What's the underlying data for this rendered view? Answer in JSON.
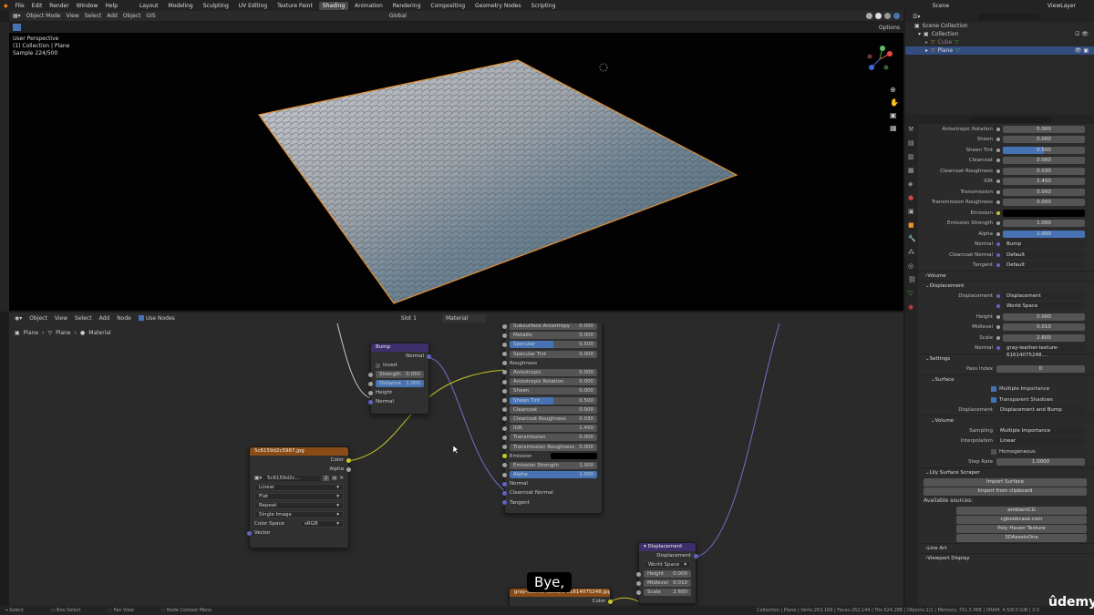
{
  "menu": [
    "File",
    "Edit",
    "Render",
    "Window",
    "Help"
  ],
  "workspaces": [
    "Layout",
    "Modeling",
    "Sculpting",
    "UV Editing",
    "Texture Paint",
    "Shading",
    "Animation",
    "Rendering",
    "Compositing",
    "Geometry Nodes",
    "Scripting"
  ],
  "active_workspace": "Shading",
  "scene": "Scene",
  "view_layer": "ViewLayer",
  "viewport_header": {
    "mode": "Object Mode",
    "items": [
      "View",
      "Select",
      "Add",
      "Object"
    ],
    "gis": "GIS",
    "transform": "Global",
    "options": "Options"
  },
  "viewport_info": [
    "User Perspective",
    "(1) Collection | Plane",
    "Sample 224/500"
  ],
  "outliner": {
    "root": "Scene Collection",
    "collection": "Collection",
    "items": [
      "Cube",
      "Plane"
    ]
  },
  "node_header": {
    "mode": "Object",
    "items": [
      "View",
      "Select",
      "Add",
      "Node"
    ],
    "use_nodes": "Use Nodes",
    "slot": "Slot 1",
    "material": "Material"
  },
  "breadcrumb": [
    "Plane",
    "Plane",
    "Material"
  ],
  "bump_node": {
    "title": "Bump",
    "output": "Normal",
    "invert": "Invert",
    "strength_label": "Strength",
    "strength": "0.050",
    "distance_label": "Distance",
    "distance": "1.000",
    "height": "Height",
    "normal": "Normal"
  },
  "image_node": {
    "title": "5c6159d2c5987.jpg",
    "out_color": "Color",
    "out_alpha": "Alpha",
    "image_name": "5c6159d2c...",
    "users": "2",
    "interp": "Linear",
    "proj": "Flat",
    "ext": "Repeat",
    "source": "Single Image",
    "cs_label": "Color Space",
    "cs": "sRGB",
    "vector": "Vector"
  },
  "bsdf_node": {
    "rows": [
      {
        "l": "Subsurface Anisotropy",
        "v": "0.000",
        "t": "n"
      },
      {
        "l": "Metallic",
        "v": "0.000",
        "t": "n"
      },
      {
        "l": "Specular",
        "v": "0.500",
        "t": "b"
      },
      {
        "l": "Specular Tint",
        "v": "0.000",
        "t": "n"
      },
      {
        "l": "Roughness",
        "v": "",
        "t": "s"
      },
      {
        "l": "Anisotropic",
        "v": "0.000",
        "t": "n"
      },
      {
        "l": "Anisotropic Rotation",
        "v": "0.000",
        "t": "n"
      },
      {
        "l": "Sheen",
        "v": "0.000",
        "t": "n"
      },
      {
        "l": "Sheen Tint",
        "v": "0.500",
        "t": "b"
      },
      {
        "l": "Clearcoat",
        "v": "0.000",
        "t": "n"
      },
      {
        "l": "Clearcoat Roughness",
        "v": "0.030",
        "t": "n"
      },
      {
        "l": "IOR",
        "v": "1.450",
        "t": "n"
      },
      {
        "l": "Transmission",
        "v": "0.000",
        "t": "n"
      },
      {
        "l": "Transmission Roughness",
        "v": "0.000",
        "t": "n"
      },
      {
        "l": "Emission",
        "v": "",
        "t": "e"
      },
      {
        "l": "Emission Strength",
        "v": "1.000",
        "t": "n"
      },
      {
        "l": "Alpha",
        "v": "1.000",
        "t": "f"
      },
      {
        "l": "Normal",
        "v": "",
        "t": "s"
      },
      {
        "l": "Clearcoat Normal",
        "v": "",
        "t": "s"
      },
      {
        "l": "Tangent",
        "v": "",
        "t": "s"
      }
    ]
  },
  "disp_node": {
    "title": "Displacement",
    "output": "Displacement",
    "space": "World Space",
    "height_label": "Height",
    "height": "0.000",
    "mid_label": "Midlevel",
    "mid": "0.010",
    "scale_label": "Scale",
    "scale": "2.600"
  },
  "image_node2": {
    "title": "gray-leather-texture-61614075248.jpg",
    "out": "Color"
  },
  "props": {
    "rows": [
      {
        "l": "Anisotropic Rotation",
        "v": "0.000",
        "t": "n"
      },
      {
        "l": "Sheen",
        "v": "0.000",
        "t": "n"
      },
      {
        "l": "Sheen Tint",
        "v": "0.500",
        "t": "b"
      },
      {
        "l": "Clearcoat",
        "v": "0.000",
        "t": "n"
      },
      {
        "l": "Clearcoat Roughness",
        "v": "0.030",
        "t": "n"
      },
      {
        "l": "IOR",
        "v": "1.450",
        "t": "n"
      },
      {
        "l": "Transmission",
        "v": "0.000",
        "t": "n"
      },
      {
        "l": "Transmission Roughness",
        "v": "0.000",
        "t": "n"
      },
      {
        "l": "Emission",
        "v": "",
        "t": "k"
      },
      {
        "l": "Emission Strength",
        "v": "1.000",
        "t": "n"
      },
      {
        "l": "Alpha",
        "v": "1.000",
        "t": "f"
      },
      {
        "l": "Normal",
        "v": "Bump",
        "t": "d"
      },
      {
        "l": "Clearcoat Normal",
        "v": "Default",
        "t": "d"
      },
      {
        "l": "Tangent",
        "v": "Default",
        "t": "d"
      }
    ],
    "volume": "Volume",
    "displacement_section": "Displacement",
    "disp_rows": [
      {
        "l": "Displacement",
        "v": "Displacement",
        "t": "d"
      },
      {
        "l": "",
        "v": "World Space",
        "t": "d"
      },
      {
        "l": "Height",
        "v": "0.000",
        "t": "n"
      },
      {
        "l": "Midlevel",
        "v": "0.010",
        "t": "n"
      },
      {
        "l": "Scale",
        "v": "2.600",
        "t": "n"
      },
      {
        "l": "Normal",
        "v": "gray-leather-texture-61614075248....",
        "t": "d"
      }
    ],
    "settings": "Settings",
    "pass_index_label": "Pass Index",
    "pass_index": "0",
    "surface": "Surface",
    "multi_imp": "Multiple Importance",
    "transp_shadows": "Transparent Shadows",
    "disp_method_label": "Displacement",
    "disp_method": "Displacement and Bump",
    "volume2": "Volume",
    "sampling_label": "Sampling",
    "sampling": "Multiple Importance",
    "interp_label": "Interpolation",
    "interp": "Linear",
    "homogeneous": "Homogeneous",
    "step_label": "Step Rate",
    "step": "1.0000",
    "lily": "Lily Surface Scraper",
    "import_surface": "Import Surface",
    "import_clip": "Import from clipboard",
    "sources_label": "Available sources:",
    "sources": [
      "ambientCG",
      "cgbookcase.com",
      "Poly Haven Texture",
      "3DAssetsOne"
    ],
    "line_art": "Line Art",
    "viewport_display": "Viewport Display"
  },
  "status": {
    "select": "Select",
    "box": "Box Select",
    "pan": "Pan View",
    "ctx": "Node Context Menu",
    "stats": "Collection | Plane | Verts:263,169 | Faces:262,144 | Tris:524,288 | Objects:1/1 | Memory: 751.5 MiB | VRAM: 4.5/8.0 GiB | 3.0"
  },
  "caption": "Bye,",
  "brand": "ûdemy",
  "colors": {
    "accent": "#4772b3",
    "active_orange": "#e8912e",
    "node_bump_header": "#3d2f6b",
    "node_image_header": "#8a4c16",
    "node_disp_header": "#3d2f6b"
  }
}
